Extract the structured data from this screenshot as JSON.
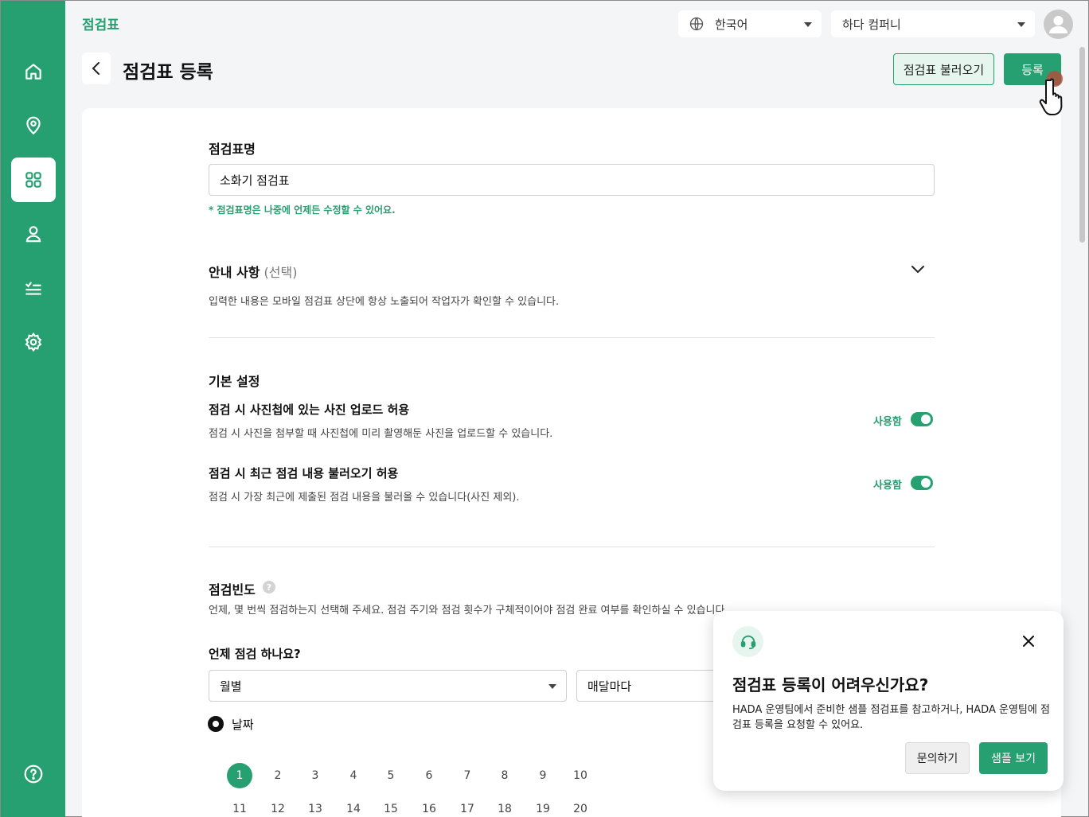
{
  "app": {
    "brand": "점검표"
  },
  "header": {
    "language": "한국어",
    "company": "하다 컴퍼니"
  },
  "page": {
    "title": "점검표 등록",
    "load_button": "점검표 불러오기",
    "register_button": "등록"
  },
  "form": {
    "name_label": "점검표명",
    "name_value": "소화기 점검표",
    "name_note": "* 점검표명은 나중에 언제든 수정할 수 있어요.",
    "notice_label": "안내 사항",
    "notice_optional": "(선택)",
    "notice_desc": "입력한 내용은 모바일 점검표 상단에 항상 노출되어 작업자가 확인할 수 있습니다.",
    "basic_title": "기본 설정",
    "settings": [
      {
        "title": "점검 시 사진첩에 있는 사진 업로드 허용",
        "desc": "점검 시 사진을 첨부할 때 사진첩에 미리 촬영해둔 사진을 업로드할 수 있습니다.",
        "toggle_label": "사용함",
        "enabled": true
      },
      {
        "title": "점검 시 최근 점검 내용 불러오기 허용",
        "desc": "점검 시 가장 최근에 제출된 점검 내용을 불러올 수 있습니다(사진 제외).",
        "toggle_label": "사용함",
        "enabled": true
      }
    ],
    "freq_title": "점검빈도",
    "freq_help": "?",
    "freq_desc": "언제, 몇 번씩 점검하는지 선택해 주세요. 점검 주기와 점검 횟수가 구체적이어야 점검 완료 여부를 확인하실 수 있습니다.",
    "when_label": "언제 점검 하나요?",
    "period_select": "월별",
    "period_detail": "매달마다",
    "radio_label": "날짜",
    "days_row1": [
      "1",
      "2",
      "3",
      "4",
      "5",
      "6",
      "7",
      "8",
      "9",
      "10"
    ],
    "days_row2": [
      "11",
      "12",
      "13",
      "14",
      "15",
      "16",
      "17",
      "18",
      "19",
      "20"
    ],
    "selected_day": "1"
  },
  "popup": {
    "title": "점검표 등록이 어려우신가요?",
    "text": "HADA 운영팀에서 준비한 샘플 점검표를 참고하거나, HADA 운영팀에 점검표 등록을 요청할 수 있어요.",
    "ask_button": "문의하기",
    "sample_button": "샘플 보기"
  },
  "colors": {
    "accent": "#27a071",
    "accent_light": "#e6f5ee"
  }
}
